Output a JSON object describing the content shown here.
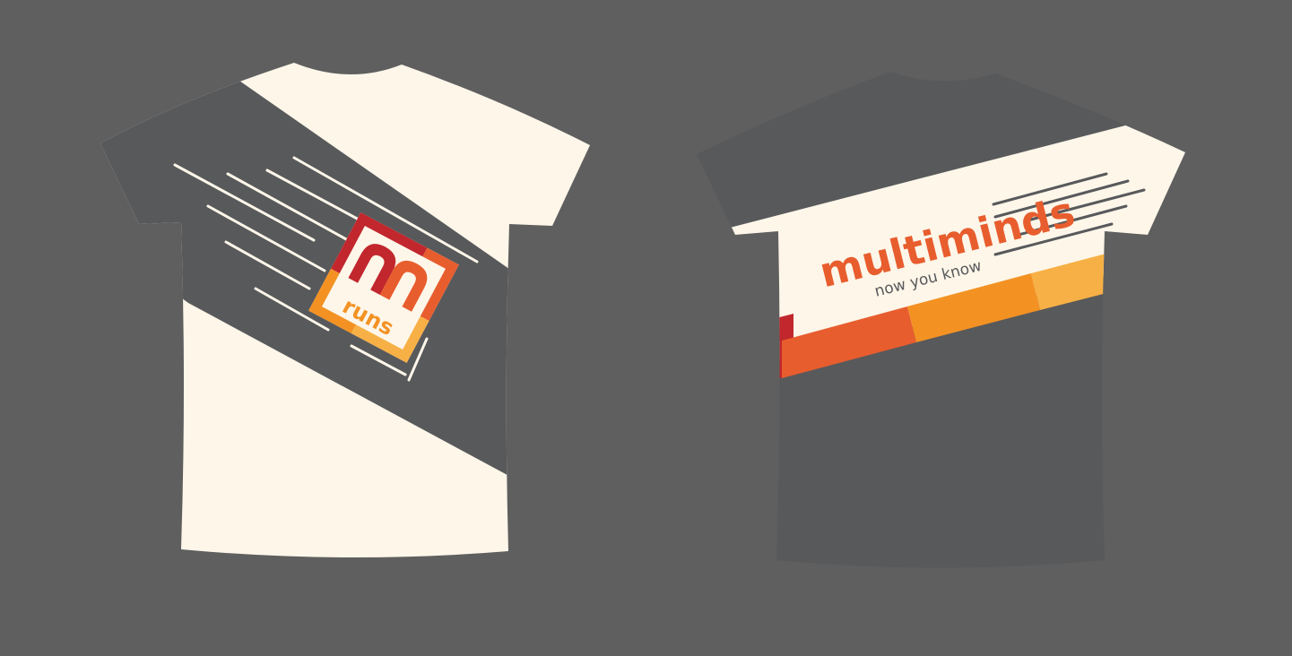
{
  "colors": {
    "background": "#5f5f5f",
    "shirt_cream": "#fdf6e9",
    "shirt_gray": "#58595b",
    "red": "#c1272d",
    "orange_red": "#e85d2e",
    "orange": "#f39223",
    "light_orange": "#f7b045"
  },
  "back_shirt": {
    "logo": {
      "letter": "m",
      "word": "runs"
    }
  },
  "front_shirt": {
    "brand": "multiminds",
    "tagline": "now you know"
  }
}
